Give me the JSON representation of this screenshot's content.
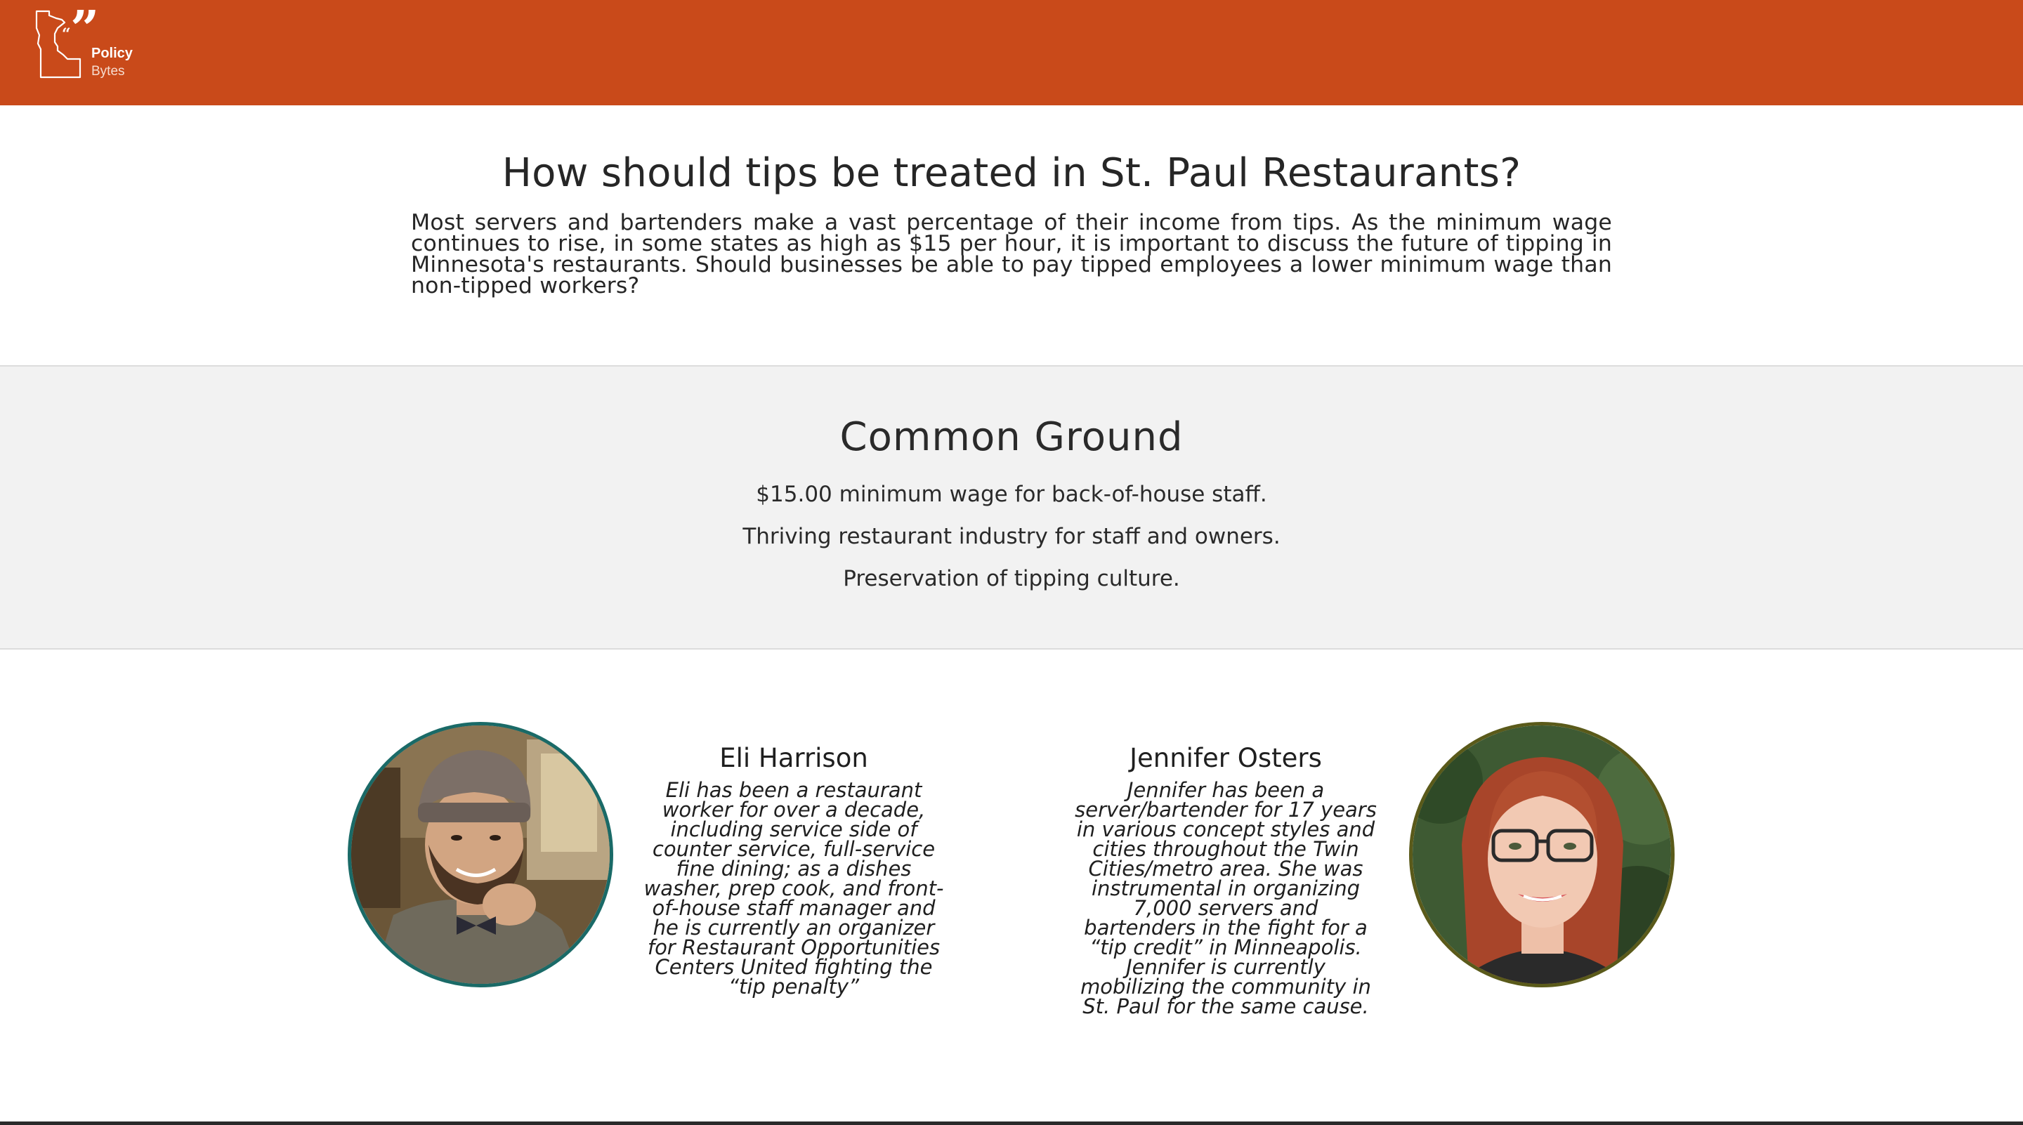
{
  "header": {
    "logo_line1": "Policy",
    "logo_line2": "Bytes",
    "logo_icon": "minnesota-quote-icon",
    "brand_color": "#c94a1a"
  },
  "intro": {
    "title": "How should tips be treated in St. Paul Restaurants?",
    "body": "Most servers and bartenders make a vast percentage of their income from tips. As the minimum wage continues to rise, in some states as high as $15 per hour, it is important to discuss the future of tipping in Minnesota's restaurants. Should businesses be able to pay tipped employees a lower minimum wage than non-tipped workers?"
  },
  "common_ground": {
    "title": "Common Ground",
    "items": [
      "$15.00 minimum wage for back-of-house staff.",
      "Thriving restaurant industry for staff and owners.",
      "Preservation of tipping culture."
    ]
  },
  "speakers": [
    {
      "name": "Eli Harrison",
      "bio": "Eli has been a restaurant worker for over a decade, including service side of counter service, full-service fine dining; as a dishes washer, prep cook, and front-of-house staff manager and he is currently an organizer for Restaurant Opportunities Centers United fighting the “tip penalty”",
      "ring_color": "#1a6a67"
    },
    {
      "name": "Jennifer Osters",
      "bio": "Jennifer has been a server/bartender for 17 years in various concept styles and cities throughout the Twin Cities/metro area. She was instrumental in organizing 7,000 servers and bartenders in the fight for a “tip credit” in Minneapolis. Jennifer is currently mobilizing the community in St. Paul for the same cause.",
      "ring_color": "#5a5a1a"
    }
  ]
}
